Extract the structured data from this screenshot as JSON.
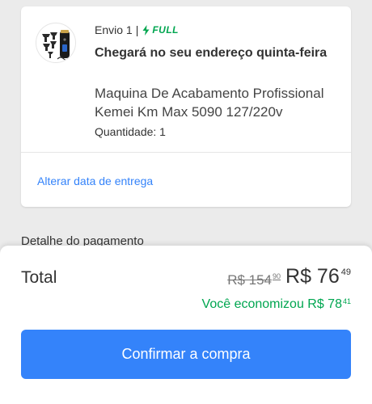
{
  "shipment": {
    "label": "Envio 1",
    "separator": "|",
    "badge": "FULL",
    "badge_color": "#00a650",
    "badge_icon": "lightning-bolt-icon",
    "eta": "Chegará no seu endereço quinta-feira",
    "product_title": "Maquina De Acabamento Profissional Kemei Km Max 5090 127/220v",
    "quantity": "Quantidade: 1",
    "change_date_link": "Alterar data de entrega",
    "link_color": "#3483fa"
  },
  "payment_detail_heading": "Detalhe do pagamento",
  "summary": {
    "total_label": "Total",
    "old_price_int": "R$ 154",
    "old_price_cents": "90",
    "new_price_int": "R$ 76",
    "new_price_cents": "49",
    "savings_text": "Você economizou R$ 78",
    "savings_cents": "41",
    "confirm_label": "Confirmar a compra",
    "button_color": "#3483fa"
  }
}
